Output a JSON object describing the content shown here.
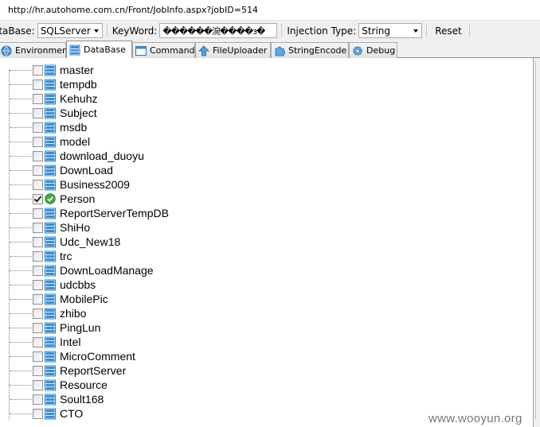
{
  "urlbar": {
    "url": "http://hr.autohome.com.cn/Front/JobInfo.aspx?jobID=514"
  },
  "toolbar": {
    "database_label": "ataBase:",
    "database_value": "SQLServer",
    "keyword_label": "KeyWord:",
    "keyword_value": "������涴����з�",
    "injection_label": "Injection Type:",
    "injection_value": "String",
    "reset_label": "Reset"
  },
  "tabs": [
    {
      "label": "Environment",
      "icon": "globe-icon"
    },
    {
      "label": "DataBase",
      "icon": "database-icon"
    },
    {
      "label": "Command",
      "icon": "window-icon"
    },
    {
      "label": "FileUploader",
      "icon": "upload-icon"
    },
    {
      "label": "StringEncode",
      "icon": "puzzle-icon"
    },
    {
      "label": "Debug",
      "icon": "gear-icon"
    }
  ],
  "active_tab": "DataBase",
  "tree": {
    "items": [
      {
        "label": "master",
        "checked": false
      },
      {
        "label": "tempdb",
        "checked": false
      },
      {
        "label": "Kehuhz",
        "checked": false
      },
      {
        "label": "Subject",
        "checked": false
      },
      {
        "label": "msdb",
        "checked": false
      },
      {
        "label": "model",
        "checked": false
      },
      {
        "label": "download_duoyu",
        "checked": false
      },
      {
        "label": "DownLoad",
        "checked": false
      },
      {
        "label": "Business2009",
        "checked": false
      },
      {
        "label": "Person",
        "checked": true
      },
      {
        "label": "ReportServerTempDB",
        "checked": false
      },
      {
        "label": "ShiHo",
        "checked": false
      },
      {
        "label": "Udc_New18",
        "checked": false
      },
      {
        "label": "trc",
        "checked": false
      },
      {
        "label": "DownLoadManage",
        "checked": false
      },
      {
        "label": "udcbbs",
        "checked": false
      },
      {
        "label": "MobilePic",
        "checked": false
      },
      {
        "label": "zhibo",
        "checked": false
      },
      {
        "label": "PingLun",
        "checked": false
      },
      {
        "label": "Intel",
        "checked": false
      },
      {
        "label": "MicroComment",
        "checked": false
      },
      {
        "label": "ReportServer",
        "checked": false
      },
      {
        "label": "Resource",
        "checked": false
      },
      {
        "label": "Soult168",
        "checked": false
      },
      {
        "label": "CTO",
        "checked": false
      }
    ]
  },
  "watermark": "www.wooyun.org",
  "colors": {
    "tab_bar": "#f0f0f0",
    "db_icon": "#3a8fd6",
    "ok_icon": "#3fae3a"
  }
}
